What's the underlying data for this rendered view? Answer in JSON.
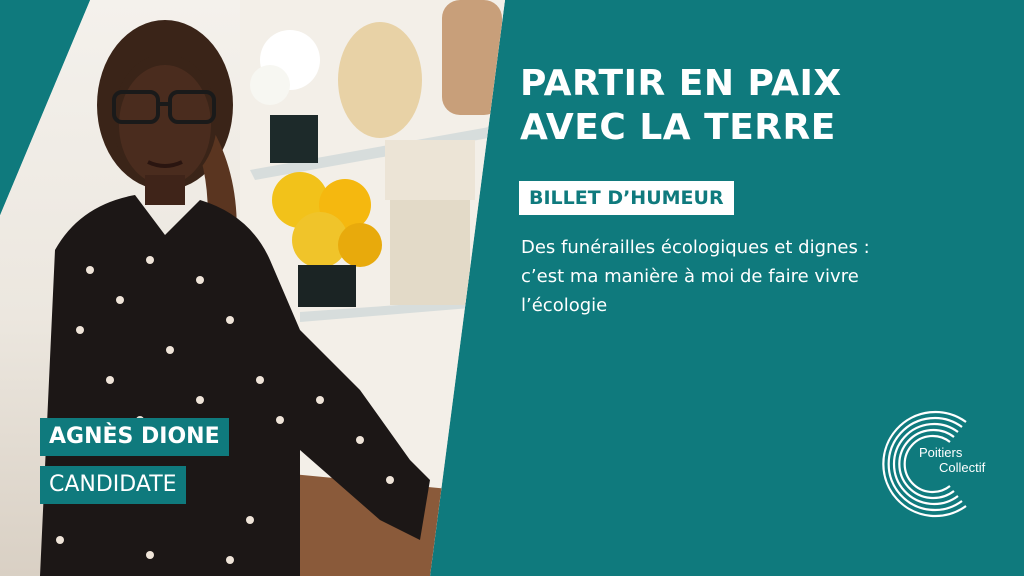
{
  "headline": {
    "line1": "PARTIR EN PAIX",
    "line2": "AVEC LA TERRE"
  },
  "tag": "BILLET D’HUMEUR",
  "description": {
    "line1": "Des funérailles écologiques et dignes :",
    "line2": "c’est ma manière à moi de faire vivre",
    "line3": "l’écologie"
  },
  "person": {
    "name": "AGNÈS DIONE",
    "role": "CANDIDATE"
  },
  "logo": {
    "line1": "Poitiers",
    "line2": "Collectif",
    "icon": "concentric-c-logo-icon"
  },
  "colors": {
    "teal": "#0f7a7d",
    "white": "#ffffff"
  }
}
